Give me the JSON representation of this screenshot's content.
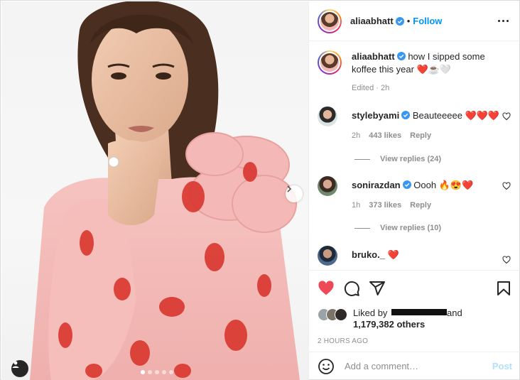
{
  "post": {
    "author": "aliaabhatt",
    "follow_label": "Follow",
    "separator": "•",
    "carousel_total": 5,
    "carousel_active_index": 0
  },
  "caption": {
    "username": "aliaabhatt",
    "text": "how I sipped some koffee this year ❤️☕🤍",
    "edited": "Edited · 2h"
  },
  "comments": [
    {
      "username": "stylebyami",
      "text": "Beauteeeee ❤️❤️❤️",
      "time": "2h",
      "likes": "443 likes",
      "reply_label": "Reply",
      "view_replies": "View replies (24)"
    },
    {
      "username": "sonirazdan",
      "text": "Oooh 🔥😍❤️",
      "time": "1h",
      "likes": "373 likes",
      "reply_label": "Reply",
      "view_replies": "View replies (10)"
    },
    {
      "username": "bruko._",
      "text": "❤️"
    }
  ],
  "likes": {
    "liked_by_prefix": "Liked by",
    "and": "and",
    "count": "1,179,382 others"
  },
  "time_ago": "2 HOURS AGO",
  "add_comment": {
    "placeholder": "Add a comment…",
    "post_label": "Post"
  },
  "colors": {
    "accent": "#0095f6",
    "like_red": "#ed4956",
    "muted": "#8e8e8e",
    "post_disabled": "#b2dffc"
  },
  "icons": {
    "like": "heart-filled-icon",
    "comment": "comment-bubble-icon",
    "share": "paper-plane-icon",
    "save": "bookmark-icon",
    "emoji": "smiley-icon",
    "more": "more-horizontal-icon",
    "next": "chevron-right-icon",
    "tags": "user-tag-icon"
  }
}
